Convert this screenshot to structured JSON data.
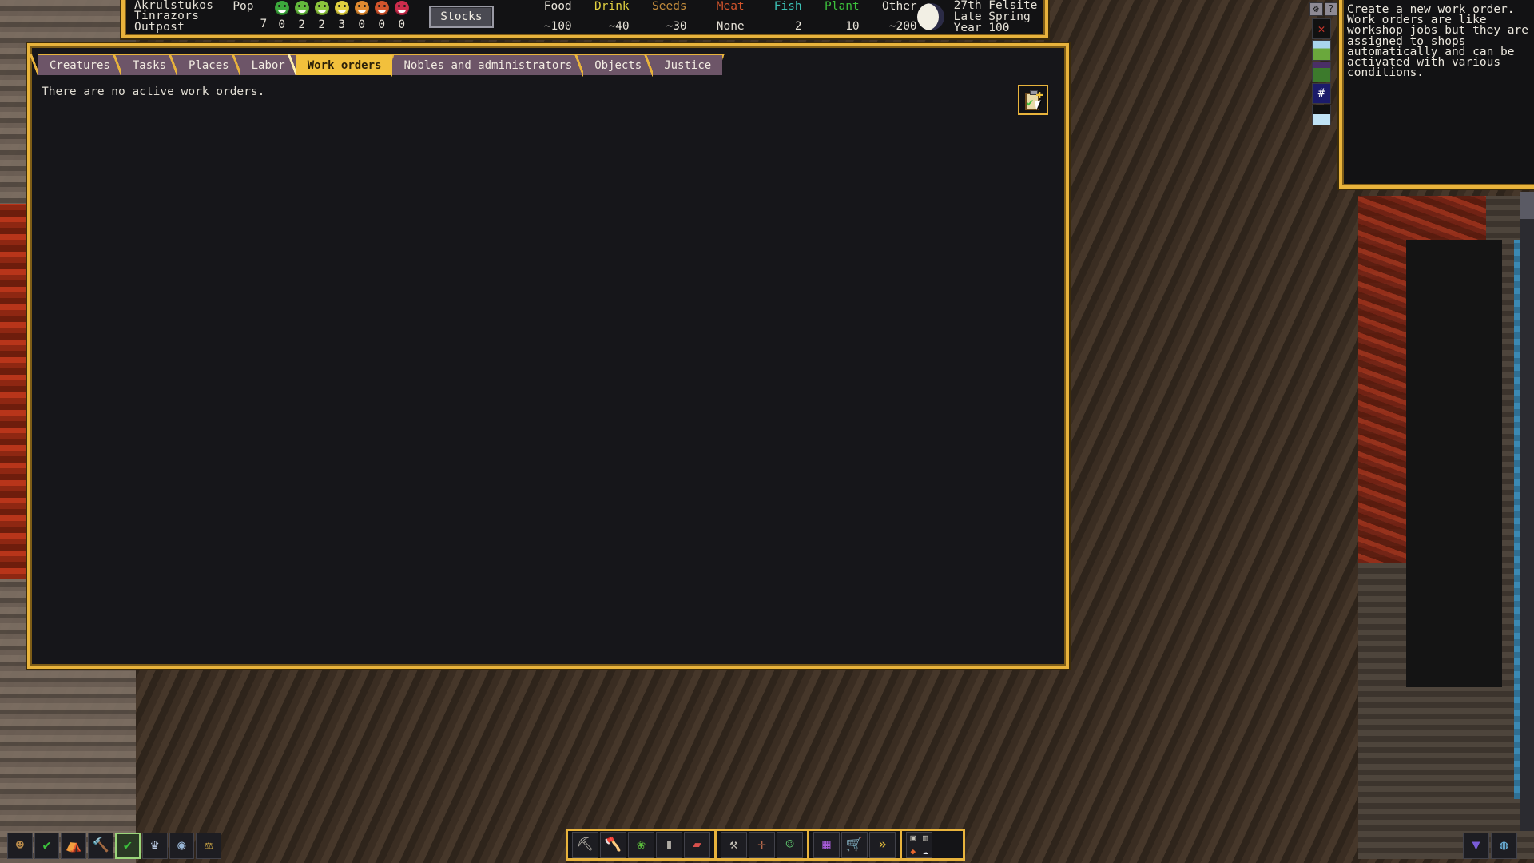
{
  "fortress": {
    "name_line1": "Akrulstukos",
    "name_line2": "Tinrazors",
    "type": "Outpost"
  },
  "population": {
    "label": "Pop",
    "total": "7",
    "moods": [
      {
        "name": "ecstatic",
        "color": "#3ca83c",
        "count": "0"
      },
      {
        "name": "happy",
        "color": "#63b83c",
        "count": "2"
      },
      {
        "name": "content",
        "color": "#8cc43c",
        "count": "2"
      },
      {
        "name": "fine",
        "color": "#e0d040",
        "count": "3"
      },
      {
        "name": "unhappy",
        "color": "#e08a30",
        "count": "0"
      },
      {
        "name": "miserable",
        "color": "#d2542c",
        "count": "0"
      },
      {
        "name": "furious",
        "color": "#cc2c4c",
        "count": "0"
      }
    ]
  },
  "stocks_button": "Stocks",
  "resources": [
    {
      "label": "Food",
      "value": "~100",
      "color": "#e8e4da"
    },
    {
      "label": "Drink",
      "value": "~40",
      "color": "#e0d040"
    },
    {
      "label": "Seeds",
      "value": "~30",
      "color": "#c08a3c"
    },
    {
      "label": "Meat",
      "value": "None",
      "color": "#d2542c"
    },
    {
      "label": "Fish",
      "value": "2",
      "color": "#3cc0b4"
    },
    {
      "label": "Plant",
      "value": "10",
      "color": "#3cc03c"
    },
    {
      "label": "Other",
      "value": "~200",
      "color": "#e8e4da"
    }
  ],
  "date": {
    "day": "27th Felsite",
    "season": "Late Spring",
    "year": "Year 100",
    "moon_icon": "moon-icon"
  },
  "tabs": [
    {
      "label": "Creatures",
      "active": false
    },
    {
      "label": "Tasks",
      "active": false
    },
    {
      "label": "Places",
      "active": false
    },
    {
      "label": "Labor",
      "active": false
    },
    {
      "label": "Work orders",
      "active": true
    },
    {
      "label": "Nobles and administrators",
      "active": false
    },
    {
      "label": "Objects",
      "active": false
    },
    {
      "label": "Justice",
      "active": false
    }
  ],
  "main": {
    "empty_message": "There are no active work orders.",
    "new_order_icon": "new-work-order-icon"
  },
  "tooltip": {
    "text": "Create a new work order.  Work orders are like workshop jobs but they are assigned to shops automatically and can be activated with various conditions."
  },
  "right_column": {
    "gear_icon": "⚙",
    "help_icon": "?",
    "tiles": [
      {
        "name": "clear-designation-icon"
      },
      {
        "name": "surface-view-icon"
      },
      {
        "name": "forest-view-icon"
      },
      {
        "name": "grid-view-icon"
      },
      {
        "name": "water-view-icon"
      }
    ]
  },
  "bottom_left_toolbar": [
    {
      "name": "citizens-icon",
      "glyph": "☻",
      "color": "#b88a4a",
      "active": false
    },
    {
      "name": "tasks-icon",
      "glyph": "✔",
      "color": "#3cc03c",
      "active": false
    },
    {
      "name": "places-icon",
      "glyph": "⛺",
      "color": "#9ad0e0",
      "active": false
    },
    {
      "name": "labor-icon",
      "glyph": "🔨",
      "color": "#d8d4ca",
      "active": false
    },
    {
      "name": "work-orders-icon",
      "glyph": "✔",
      "color": "#3cc03c",
      "active": true
    },
    {
      "name": "nobles-icon",
      "glyph": "♛",
      "color": "#b8c8e0",
      "active": false
    },
    {
      "name": "objects-icon",
      "glyph": "◉",
      "color": "#9ab8d8",
      "active": false
    },
    {
      "name": "justice-icon",
      "glyph": "⚖",
      "color": "#d8b048",
      "active": false
    }
  ],
  "bottom_center_toolbar": {
    "group1": [
      {
        "name": "mine-icon",
        "glyph": "⛏",
        "color": "#c8c4ba"
      },
      {
        "name": "chop-trees-icon",
        "glyph": "🪓",
        "color": "#c07a3c"
      },
      {
        "name": "gather-plants-icon",
        "glyph": "❀",
        "color": "#5cc03c"
      },
      {
        "name": "smooth-stone-icon",
        "glyph": "▮",
        "color": "#b0aca4"
      },
      {
        "name": "erase-designation-icon",
        "glyph": "▰",
        "color": "#d8504c"
      }
    ],
    "group2": [
      {
        "name": "build-icon",
        "glyph": "⚒",
        "color": "#c8c4ba"
      },
      {
        "name": "furniture-icon",
        "glyph": "✛",
        "color": "#b86a4c"
      },
      {
        "name": "zones-icon",
        "glyph": "☺",
        "color": "#5cc06c"
      }
    ],
    "group3": [
      {
        "name": "stockpiles-icon",
        "glyph": "▦",
        "color": "#a85cd8"
      },
      {
        "name": "hauling-icon",
        "glyph": "🛒",
        "color": "#b0aca4"
      },
      {
        "name": "more-tools-icon",
        "glyph": "»",
        "color": "#e8c03c"
      }
    ],
    "group4": [
      {
        "name": "lock-icon",
        "glyph": "▣",
        "color": "#c8c4ba"
      },
      {
        "name": "trash-icon",
        "glyph": "▥",
        "color": "#c8c4ba"
      },
      {
        "name": "magma-icon",
        "glyph": "◆",
        "color": "#e8662c"
      },
      {
        "name": "water-icon",
        "glyph": "☁",
        "color": "#e8eef4"
      }
    ]
  },
  "bottom_right_toolbar": [
    {
      "name": "announcements-icon",
      "glyph": "▼",
      "color": "#7a5cd8"
    },
    {
      "name": "world-map-icon",
      "glyph": "◍",
      "color": "#6ab0d8"
    }
  ],
  "colors": {
    "frame_gold": "#e8b33c",
    "tab_inactive": "#6d5568",
    "tab_active": "#f2c03c",
    "panel_bg": "#16161a"
  }
}
